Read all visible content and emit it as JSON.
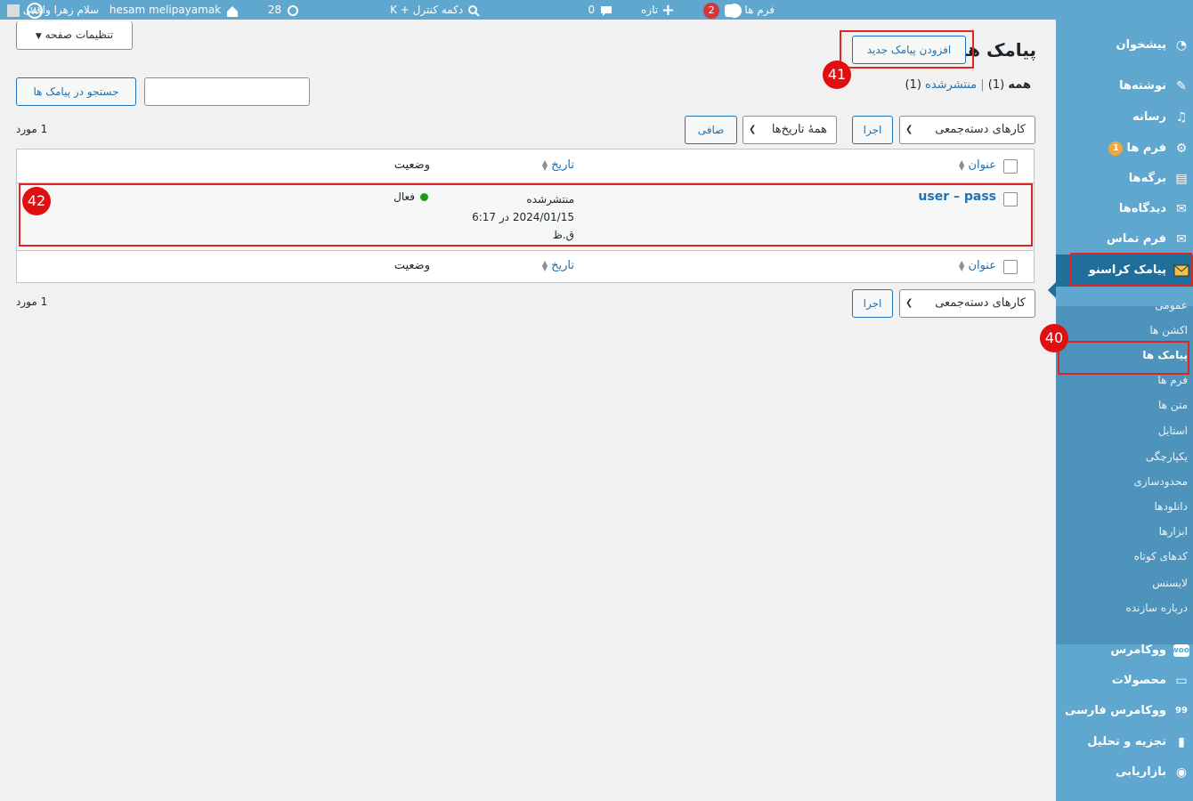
{
  "adminbar": {
    "greeting": "سلام زهرا واقفی",
    "site_name": "hesam melipayamak",
    "updates_count": "28",
    "search_label": "دکمه کنترل + K",
    "comments_count": "0",
    "new_label": "تازه",
    "forms_label": "فرم ها",
    "forms_count": "2"
  },
  "sidebar": {
    "items": [
      {
        "label": "پیشخوان",
        "icon": "dashboard-icon"
      },
      {
        "label": "نوشته‌ها",
        "icon": "pin-icon"
      },
      {
        "label": "رسانه",
        "icon": "media-icon"
      },
      {
        "label": "فرم ها",
        "icon": "forms-icon",
        "badge": "1"
      },
      {
        "label": "برگه‌ها",
        "icon": "pages-icon"
      },
      {
        "label": "دیدگاه‌ها",
        "icon": "comments-icon"
      },
      {
        "label": "فرم تماس",
        "icon": "mail-icon"
      },
      {
        "label": "پیامک کراسنو",
        "icon": "envelope-icon"
      },
      {
        "label": "ووکامرس",
        "icon": "woo-icon"
      },
      {
        "label": "محصولات",
        "icon": "products-icon"
      },
      {
        "label": "ووکامرس فارسی",
        "icon": "woo-persian-icon"
      },
      {
        "label": "تجزیه و تحلیل",
        "icon": "analytics-icon"
      },
      {
        "label": "بازاریابی",
        "icon": "megaphone-icon"
      }
    ],
    "submenu": [
      "عمومی",
      "اکشن ها",
      "پیامک ها",
      "فرم ها",
      "متن ها",
      "استایل",
      "یکپارچگی",
      "محدودسازی",
      "دانلودها",
      "ابزارها",
      "کدهای کوتاه",
      "لایسنس",
      "درباره سازنده"
    ]
  },
  "page": {
    "title": "پیامک ها",
    "add_new_label": "افزودن پیامک جدید",
    "screen_options_label": "تنظیمات صفحه",
    "filter_all": "همه",
    "filter_all_count": "(1)",
    "filter_published": "منتشرشده",
    "filter_published_count": "(1)",
    "search_button": "جستجو در پیامک ها",
    "search_value": "",
    "bulk_actions": "کارهای دسته‌جمعی",
    "apply_label": "اجرا",
    "all_dates": "همهٔ تاریخ‌ها",
    "filter_label": "صافی",
    "item_count": "1 مورد"
  },
  "table": {
    "columns": {
      "title": "عنوان",
      "date": "تاریخ",
      "status": "وضعیت"
    },
    "rows": [
      {
        "title": "user – pass",
        "date_status": "منتشرشده",
        "date_line": "2024/01/15 در 6:17",
        "date_suffix": "ق.ظ",
        "status": "فعال"
      }
    ]
  },
  "annotations": {
    "m40": "40",
    "m41": "41",
    "m42": "42"
  },
  "colors": {
    "sidebar": "#5fa7cf",
    "active": "#1f6f9a",
    "link": "#2271b1",
    "highlight": "#e02424",
    "status_dot": "#1a9e1a"
  }
}
